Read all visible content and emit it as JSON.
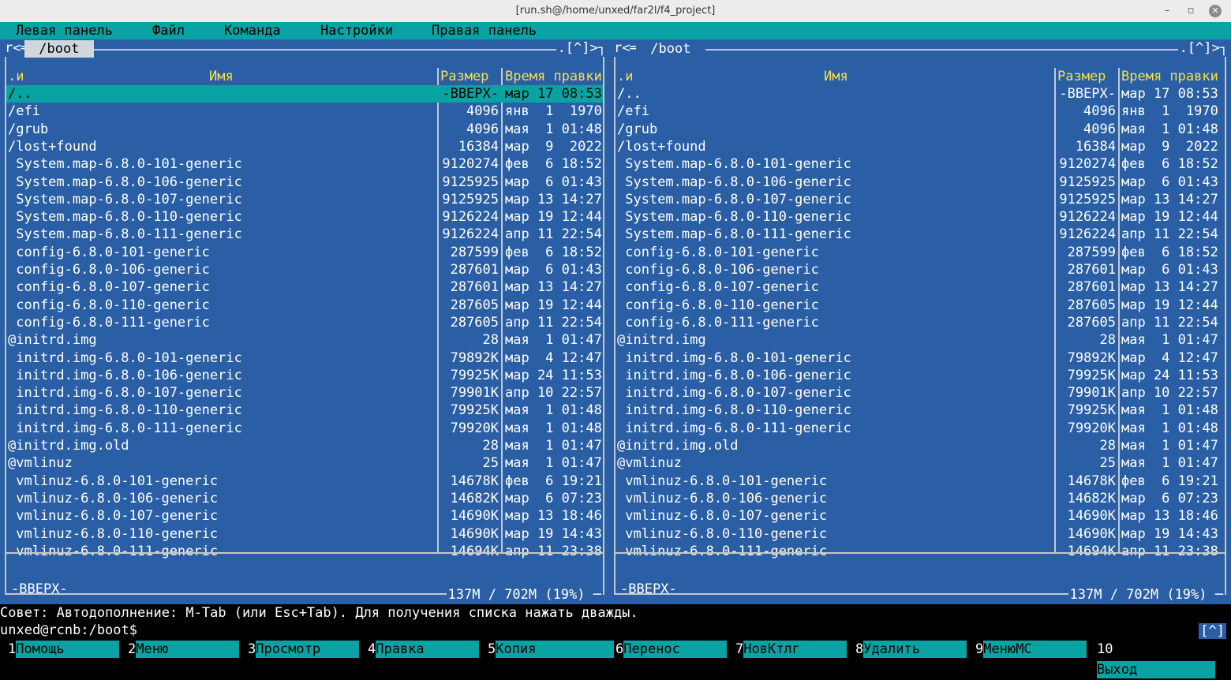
{
  "window": {
    "title": "[run.sh@/home/unxed/far2l/f4_project]"
  },
  "menu": [
    "Левая панель",
    "Файл",
    "Команда",
    "Настройки",
    "Правая панель"
  ],
  "columns": {
    "name_mark": ".и",
    "name": "Имя",
    "size": "Размер",
    "time": "Время правки"
  },
  "frame": {
    "topleft": "r<═",
    "topright": ".[^]>┐",
    "topleft_right": "r<═"
  },
  "left_panel": {
    "path": " /boot ",
    "status": "-ВВЕРХ-",
    "disk": "137M / 702M (19%)",
    "rows": [
      {
        "name": "/..",
        "size": "-ВВЕРХ-",
        "date": "мар 17 08:53"
      },
      {
        "name": "/efi",
        "size": "4096",
        "date": "янв  1  1970"
      },
      {
        "name": "/grub",
        "size": "4096",
        "date": "мая  1 01:48"
      },
      {
        "name": "/lost+found",
        "size": "16384",
        "date": "мар  9  2022"
      },
      {
        "name": " System.map-6.8.0-101-generic",
        "size": "9120274",
        "date": "фев  6 18:52"
      },
      {
        "name": " System.map-6.8.0-106-generic",
        "size": "9125925",
        "date": "мар  6 01:43"
      },
      {
        "name": " System.map-6.8.0-107-generic",
        "size": "9125925",
        "date": "мар 13 14:27"
      },
      {
        "name": " System.map-6.8.0-110-generic",
        "size": "9126224",
        "date": "мар 19 12:44"
      },
      {
        "name": " System.map-6.8.0-111-generic",
        "size": "9126224",
        "date": "апр 11 22:54"
      },
      {
        "name": " config-6.8.0-101-generic",
        "size": "287599",
        "date": "фев  6 18:52"
      },
      {
        "name": " config-6.8.0-106-generic",
        "size": "287601",
        "date": "мар  6 01:43"
      },
      {
        "name": " config-6.8.0-107-generic",
        "size": "287601",
        "date": "мар 13 14:27"
      },
      {
        "name": " config-6.8.0-110-generic",
        "size": "287605",
        "date": "мар 19 12:44"
      },
      {
        "name": " config-6.8.0-111-generic",
        "size": "287605",
        "date": "апр 11 22:54"
      },
      {
        "name": "@initrd.img",
        "size": "28",
        "date": "мая  1 01:47"
      },
      {
        "name": " initrd.img-6.8.0-101-generic",
        "size": "79892K",
        "date": "мар  4 12:47"
      },
      {
        "name": " initrd.img-6.8.0-106-generic",
        "size": "79925K",
        "date": "мар 24 11:53"
      },
      {
        "name": " initrd.img-6.8.0-107-generic",
        "size": "79901K",
        "date": "апр 10 22:57"
      },
      {
        "name": " initrd.img-6.8.0-110-generic",
        "size": "79925K",
        "date": "мая  1 01:48"
      },
      {
        "name": " initrd.img-6.8.0-111-generic",
        "size": "79920K",
        "date": "мая  1 01:48"
      },
      {
        "name": "@initrd.img.old",
        "size": "28",
        "date": "мая  1 01:47"
      },
      {
        "name": "@vmlinuz",
        "size": "25",
        "date": "мая  1 01:47"
      },
      {
        "name": " vmlinuz-6.8.0-101-generic",
        "size": "14678K",
        "date": "фев  6 19:21"
      },
      {
        "name": " vmlinuz-6.8.0-106-generic",
        "size": "14682K",
        "date": "мар  6 07:23"
      },
      {
        "name": " vmlinuz-6.8.0-107-generic",
        "size": "14690K",
        "date": "мар 13 18:46"
      },
      {
        "name": " vmlinuz-6.8.0-110-generic",
        "size": "14690K",
        "date": "мар 19 14:43"
      },
      {
        "name": " vmlinuz-6.8.0-111-generic",
        "size": "14694K",
        "date": "апр 11 23:38"
      }
    ]
  },
  "right_panel": {
    "path": " /boot ",
    "status": "-ВВЕРХ-",
    "disk": "137M / 702M (19%)",
    "rows": [
      {
        "name": "/..",
        "size": "-ВВЕРХ-",
        "date": "мар 17 08:53"
      },
      {
        "name": "/efi",
        "size": "4096",
        "date": "янв  1  1970"
      },
      {
        "name": "/grub",
        "size": "4096",
        "date": "мая  1 01:48"
      },
      {
        "name": "/lost+found",
        "size": "16384",
        "date": "мар  9  2022"
      },
      {
        "name": " System.map-6.8.0-101-generic",
        "size": "9120274",
        "date": "фев  6 18:52"
      },
      {
        "name": " System.map-6.8.0-106-generic",
        "size": "9125925",
        "date": "мар  6 01:43"
      },
      {
        "name": " System.map-6.8.0-107-generic",
        "size": "9125925",
        "date": "мар 13 14:27"
      },
      {
        "name": " System.map-6.8.0-110-generic",
        "size": "9126224",
        "date": "мар 19 12:44"
      },
      {
        "name": " System.map-6.8.0-111-generic",
        "size": "9126224",
        "date": "апр 11 22:54"
      },
      {
        "name": " config-6.8.0-101-generic",
        "size": "287599",
        "date": "фев  6 18:52"
      },
      {
        "name": " config-6.8.0-106-generic",
        "size": "287601",
        "date": "мар  6 01:43"
      },
      {
        "name": " config-6.8.0-107-generic",
        "size": "287601",
        "date": "мар 13 14:27"
      },
      {
        "name": " config-6.8.0-110-generic",
        "size": "287605",
        "date": "мар 19 12:44"
      },
      {
        "name": " config-6.8.0-111-generic",
        "size": "287605",
        "date": "апр 11 22:54"
      },
      {
        "name": "@initrd.img",
        "size": "28",
        "date": "мая  1 01:47"
      },
      {
        "name": " initrd.img-6.8.0-101-generic",
        "size": "79892K",
        "date": "мар  4 12:47"
      },
      {
        "name": " initrd.img-6.8.0-106-generic",
        "size": "79925K",
        "date": "мар 24 11:53"
      },
      {
        "name": " initrd.img-6.8.0-107-generic",
        "size": "79901K",
        "date": "апр 10 22:57"
      },
      {
        "name": " initrd.img-6.8.0-110-generic",
        "size": "79925K",
        "date": "мая  1 01:48"
      },
      {
        "name": " initrd.img-6.8.0-111-generic",
        "size": "79920K",
        "date": "мая  1 01:48"
      },
      {
        "name": "@initrd.img.old",
        "size": "28",
        "date": "мая  1 01:47"
      },
      {
        "name": "@vmlinuz",
        "size": "25",
        "date": "мая  1 01:47"
      },
      {
        "name": " vmlinuz-6.8.0-101-generic",
        "size": "14678K",
        "date": "фев  6 19:21"
      },
      {
        "name": " vmlinuz-6.8.0-106-generic",
        "size": "14682K",
        "date": "мар  6 07:23"
      },
      {
        "name": " vmlinuz-6.8.0-107-generic",
        "size": "14690K",
        "date": "мар 13 18:46"
      },
      {
        "name": " vmlinuz-6.8.0-110-generic",
        "size": "14690K",
        "date": "мар 19 14:43"
      },
      {
        "name": " vmlinuz-6.8.0-111-generic",
        "size": "14694K",
        "date": "апр 11 23:38"
      }
    ]
  },
  "hint": "Совет: Автодополнение: M-Tab (или Esc+Tab). Для получения списка нажать дважды.",
  "prompt": "unxed@rcnb:/boot$",
  "bracket": "[^]",
  "keys": [
    {
      "num": "1",
      "label": "Помощь"
    },
    {
      "num": "2",
      "label": "Меню"
    },
    {
      "num": "3",
      "label": "Просмотр"
    },
    {
      "num": "4",
      "label": "Правка"
    },
    {
      "num": "5",
      "label": "Копия"
    },
    {
      "num": "6",
      "label": "Перенос"
    },
    {
      "num": "7",
      "label": "НовКтлг"
    },
    {
      "num": "8",
      "label": "Удалить"
    },
    {
      "num": "9",
      "label": "МенюMC"
    },
    {
      "num": "10",
      "label": "Выход"
    }
  ],
  "colors": {
    "panel_bg": "#2a5fa5",
    "cursor_bg": "#0aa3a3",
    "header_fg": "#f5e04a"
  }
}
